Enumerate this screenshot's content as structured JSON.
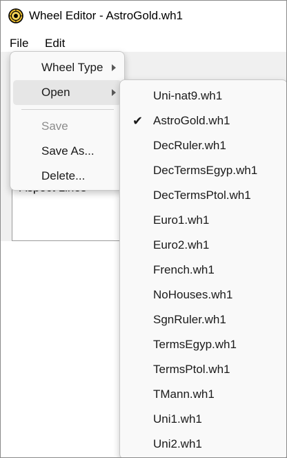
{
  "window": {
    "title": "Wheel Editor - AstroGold.wh1",
    "app_icon": "astro-wheel-icon"
  },
  "menubar": {
    "items": [
      {
        "label": "File"
      },
      {
        "label": "Edit"
      }
    ]
  },
  "background": {
    "list_item": "Aspect Lines"
  },
  "file_menu": {
    "items": [
      {
        "label": "Wheel Type",
        "has_submenu": true
      },
      {
        "label": "Open",
        "has_submenu": true,
        "highlighted": true
      },
      {
        "label": "Save",
        "disabled": true
      },
      {
        "label": "Save As..."
      },
      {
        "label": "Delete..."
      }
    ]
  },
  "open_submenu": {
    "checked_index": 1,
    "items": [
      {
        "label": "Uni-nat9.wh1"
      },
      {
        "label": "AstroGold.wh1"
      },
      {
        "label": "DecRuler.wh1"
      },
      {
        "label": "DecTermsEgyp.wh1"
      },
      {
        "label": "DecTermsPtol.wh1"
      },
      {
        "label": "Euro1.wh1"
      },
      {
        "label": "Euro2.wh1"
      },
      {
        "label": "French.wh1"
      },
      {
        "label": "NoHouses.wh1"
      },
      {
        "label": "SgnRuler.wh1"
      },
      {
        "label": "TermsEgyp.wh1"
      },
      {
        "label": "TermsPtol.wh1"
      },
      {
        "label": "TMann.wh1"
      },
      {
        "label": "Uni1.wh1"
      },
      {
        "label": "Uni2.wh1"
      }
    ]
  },
  "colors": {
    "menu_background": "#f9f9f9",
    "menu_highlight": "#e6e6e6",
    "disabled_text": "#8c8c8c",
    "icon_gold": "#e8b92a"
  }
}
